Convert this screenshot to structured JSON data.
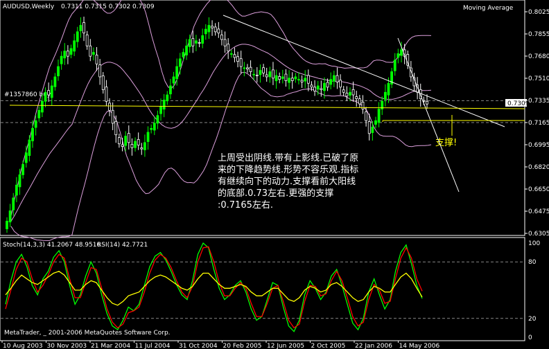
{
  "header": {
    "symbol": "AUDUSD,Weekly",
    "ohlc": "0.7311 0.7315 0.7302 0.7309",
    "indicator": "Moving Average"
  },
  "price_tag": "0.7309",
  "order_label": "#1357860 buy",
  "stoch_label": "Stoch(14,3,3) 41.2067 48.9516",
  "rsi_label": "RSI(14) 42.7721",
  "copyright": "MetaTrader, _ 2001-2006 MetaQuotes Software Corp.",
  "annotation": {
    "lines": [
      "上周受出阴线.带有上影线.已破了原",
      "来的下降趋势线.形势不容乐观.指标",
      "有继续向下的动力.支撑看前大阳线",
      "的底部.0.73左右.更强的支撑",
      ":0.7165左右."
    ],
    "support": "支撑!"
  },
  "colors": {
    "background": "#000000",
    "bull_candle": "#00ff00",
    "bear_candle": "#ffffff",
    "bands": "#dda0dd",
    "trendline": "#ffffff",
    "support": "#ffff00",
    "stoch_main": "#00ff00",
    "stoch_signal": "#ff0000",
    "rsi": "#ffff00"
  },
  "chart_data": [
    {
      "type": "candlestick",
      "title": "AUDUSD,Weekly",
      "x_tick_labels": [
        "10 Aug 2003",
        "30 Nov 2003",
        "21 Mar 2004",
        "11 Jul 2004",
        "31 Oct 2004",
        "20 Feb 2005",
        "12 Jun 2005",
        "2 Oct 2005",
        "22 Jan 2006",
        "14 May 2006"
      ],
      "y_tick_labels": [
        "0.8025",
        "0.7855",
        "0.7680",
        "0.7510",
        "0.7335",
        "0.7165",
        "0.6995",
        "0.6820",
        "0.6650",
        "0.6475",
        "0.6305"
      ],
      "ylim": [
        0.6305,
        0.8025
      ],
      "series": [
        {
          "name": "Close",
          "values": [
            0.64,
            0.648,
            0.658,
            0.668,
            0.676,
            0.684,
            0.693,
            0.703,
            0.712,
            0.718,
            0.726,
            0.733,
            0.74,
            0.738,
            0.745,
            0.752,
            0.76,
            0.768,
            0.772,
            0.768,
            0.774,
            0.78,
            0.787,
            0.792,
            0.786,
            0.776,
            0.768,
            0.771,
            0.762,
            0.752,
            0.742,
            0.733,
            0.726,
            0.716,
            0.707,
            0.7,
            0.698,
            0.706,
            0.701,
            0.697,
            0.702,
            0.699,
            0.696,
            0.701,
            0.709,
            0.712,
            0.716,
            0.722,
            0.729,
            0.734,
            0.738,
            0.745,
            0.752,
            0.76,
            0.766,
            0.771,
            0.776,
            0.781,
            0.776,
            0.78,
            0.778,
            0.784,
            0.789,
            0.792,
            0.79,
            0.787,
            0.786,
            0.781,
            0.776,
            0.772,
            0.77,
            0.767,
            0.764,
            0.76,
            0.759,
            0.758,
            0.756,
            0.754,
            0.753,
            0.757,
            0.755,
            0.752,
            0.756,
            0.751,
            0.753,
            0.75,
            0.752,
            0.749,
            0.751,
            0.749,
            0.752,
            0.75,
            0.748,
            0.751,
            0.747,
            0.744,
            0.741,
            0.745,
            0.742,
            0.747,
            0.744,
            0.75,
            0.753,
            0.748,
            0.744,
            0.74,
            0.737,
            0.74,
            0.738,
            0.735,
            0.731,
            0.727,
            0.718,
            0.708,
            0.713,
            0.718,
            0.727,
            0.733,
            0.74,
            0.747,
            0.756,
            0.765,
            0.77,
            0.773,
            0.768,
            0.761,
            0.752,
            0.745,
            0.74,
            0.735,
            0.733,
            0.7309
          ]
        }
      ]
    },
    {
      "type": "line",
      "title": "Stoch(14,3,3) / RSI(14)",
      "y_tick_labels": [
        "100",
        "80",
        "20",
        "0"
      ],
      "ylim": [
        0,
        100
      ],
      "series": [
        {
          "name": "Stoch(14,3,3)",
          "values": [
            35,
            60,
            80,
            88,
            75,
            55,
            45,
            62,
            70,
            85,
            92,
            80,
            55,
            35,
            45,
            65,
            80,
            68,
            45,
            25,
            12,
            8,
            18,
            32,
            28,
            35,
            55,
            75,
            86,
            90,
            82,
            70,
            56,
            45,
            40,
            60,
            88,
            100,
            95,
            72,
            52,
            40,
            45,
            55,
            60,
            48,
            30,
            18,
            22,
            40,
            58,
            55,
            32,
            12,
            6,
            18,
            45,
            60,
            52,
            40,
            48,
            65,
            72,
            55,
            35,
            15,
            8,
            20,
            48,
            62,
            45,
            30,
            40,
            70,
            90,
            98,
            78,
            55,
            41.2
          ]
        },
        {
          "name": "Signal",
          "values": [
            30,
            50,
            72,
            84,
            80,
            62,
            48,
            55,
            66,
            80,
            88,
            84,
            62,
            42,
            42,
            58,
            74,
            72,
            52,
            30,
            16,
            10,
            14,
            26,
            28,
            32,
            48,
            68,
            82,
            88,
            84,
            74,
            60,
            48,
            42,
            54,
            80,
            95,
            96,
            80,
            58,
            44,
            44,
            52,
            58,
            52,
            36,
            22,
            22,
            36,
            52,
            55,
            38,
            18,
            10,
            14,
            38,
            55,
            54,
            44,
            46,
            60,
            70,
            60,
            42,
            22,
            12,
            16,
            40,
            56,
            50,
            36,
            38,
            62,
            84,
            95,
            84,
            62,
            48.95
          ]
        },
        {
          "name": "RSI(14)",
          "values": [
            45,
            52,
            60,
            66,
            62,
            58,
            56,
            60,
            64,
            68,
            70,
            66,
            58,
            50,
            50,
            56,
            60,
            58,
            50,
            42,
            36,
            34,
            38,
            44,
            46,
            48,
            54,
            60,
            64,
            66,
            64,
            60,
            56,
            52,
            50,
            54,
            62,
            68,
            68,
            62,
            56,
            52,
            52,
            54,
            56,
            54,
            48,
            44,
            44,
            48,
            52,
            52,
            46,
            40,
            38,
            42,
            50,
            54,
            52,
            48,
            50,
            56,
            58,
            54,
            48,
            42,
            38,
            40,
            48,
            54,
            52,
            48,
            48,
            56,
            64,
            68,
            62,
            52,
            42.77
          ]
        }
      ]
    }
  ]
}
